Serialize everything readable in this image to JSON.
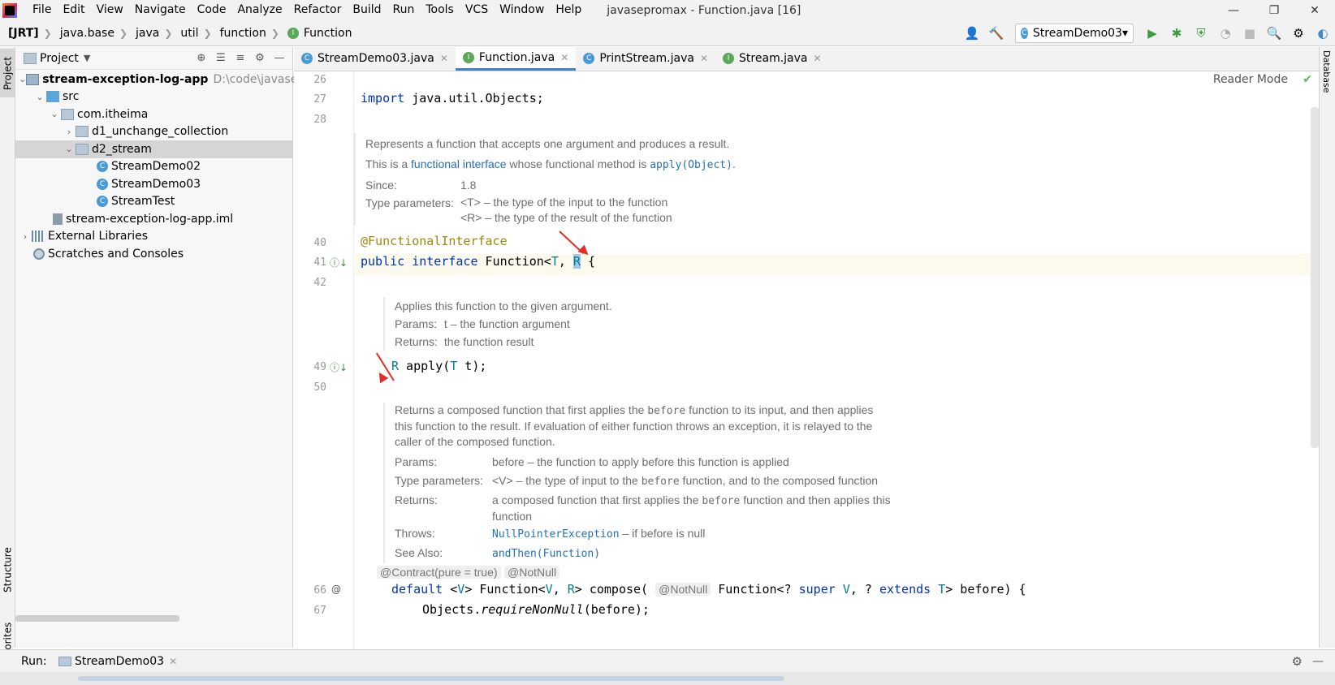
{
  "menu": [
    "File",
    "Edit",
    "View",
    "Navigate",
    "Code",
    "Analyze",
    "Refactor",
    "Build",
    "Run",
    "Tools",
    "VCS",
    "Window",
    "Help"
  ],
  "window_title": "javasepromax - Function.java [16]",
  "window_controls": {
    "minimize": "—",
    "restore": "❐",
    "close": "✕"
  },
  "breadcrumb": [
    "[JRT]",
    "java.base",
    "java",
    "util",
    "function",
    "Function"
  ],
  "run_config": "StreamDemo03",
  "left_strip": {
    "project": "Project",
    "structure": "Structure",
    "favorites": "Favorites"
  },
  "right_strip": {
    "database": "Database"
  },
  "project_panel": {
    "title": "Project",
    "tree": {
      "root": {
        "label": "stream-exception-log-app",
        "path": "D:\\code\\javasepro"
      },
      "src": "src",
      "package": "com.itheima",
      "sub1": "d1_unchange_collection",
      "sub2": "d2_stream",
      "classes": [
        "StreamDemo02",
        "StreamDemo03",
        "StreamTest"
      ],
      "iml": "stream-exception-log-app.iml",
      "libs": "External Libraries",
      "scratches": "Scratches and Consoles"
    }
  },
  "tabs": [
    {
      "label": "StreamDemo03.java",
      "icon": "C",
      "color": "#4a9ad8"
    },
    {
      "label": "Function.java",
      "icon": "I",
      "color": "#5aa95a"
    },
    {
      "label": "PrintStream.java",
      "icon": "C",
      "color": "#4a9ad8"
    },
    {
      "label": "Stream.java",
      "icon": "I",
      "color": "#5aa95a"
    }
  ],
  "editor": {
    "reader_mode": "Reader Mode",
    "lines": {
      "l26": "26",
      "l27": "27",
      "l28": "28",
      "l40": "40",
      "l41": "41",
      "l42": "42",
      "l49": "49",
      "l50": "50",
      "l66": "66",
      "l67": "67"
    },
    "import_kw": "import",
    "import_rest": " java.util.Objects;",
    "annotation": "@FunctionalInterface",
    "decl": {
      "kw1": "public",
      "kw2": "interface",
      "name": " Function<",
      "t": "T",
      "comma": ", ",
      "r": "R",
      "brace": " {"
    },
    "apply": {
      "r": "R",
      "rest": " apply(",
      "t": "T",
      "end": " t);"
    },
    "doc1": {
      "line1": "Represents a function that accepts one argument and produces a result.",
      "line2_a": "This is a ",
      "line2_link": "functional interface",
      "line2_b": " whose functional method is ",
      "line2_code": "apply(Object)",
      "line2_c": ".",
      "since_k": "Since:",
      "since_v": "1.8",
      "tp_k": "Type parameters:",
      "tp_v1": "<T> – the type of the input to the function",
      "tp_v2": "<R> – the type of the result of the function"
    },
    "doc2": {
      "line1": "Applies this function to the given argument.",
      "params_k": "Params:",
      "params_v": "t – the function argument",
      "returns_k": "Returns:",
      "returns_v": "the function result"
    },
    "doc3": {
      "p1": "Returns a composed function that first applies the ",
      "p1_code": "before",
      "p1b": " function to its input, and then applies",
      "p2": "this function to the result. If evaluation of either function throws an exception, it is relayed to the",
      "p3": "caller of the composed function.",
      "params_k": "Params:",
      "params_v": "before – the function to apply before this function is applied",
      "tp_k": "Type parameters:",
      "tp_v_a": "<V> – the type of input to the ",
      "tp_v_code": "before",
      "tp_v_b": " function, and to the composed function",
      "returns_k": "Returns:",
      "returns_v_a": "a composed function that first applies the ",
      "returns_v_code": "before",
      "returns_v_b": " function and then applies this",
      "returns_v2": "function",
      "throws_k": "Throws:",
      "throws_link": "NullPointerException",
      "throws_v": " – if before is null",
      "see_k": "See Also:",
      "see_link": "andThen(Function)"
    },
    "hints": {
      "contract": "@Contract(pure = true)",
      "notnull": "@NotNull",
      "notnull2": "@NotNull"
    },
    "compose": {
      "kw": "default",
      "a": " <",
      "v": "V",
      "b": "> Function<",
      "v2": "V",
      "c": ", ",
      "r": "R",
      "d": "> compose( ",
      "e": " Function<? ",
      "super": "super",
      "f": " ",
      "v3": "V",
      "g": ", ? ",
      "ext": "extends",
      "h": " ",
      "t": "T",
      "i": "> before) {"
    },
    "line67": {
      "a": "Objects.",
      "b": "requireNonNull",
      "c": "(before);"
    }
  },
  "run_bar": {
    "label": "Run:",
    "tab": "StreamDemo03"
  }
}
